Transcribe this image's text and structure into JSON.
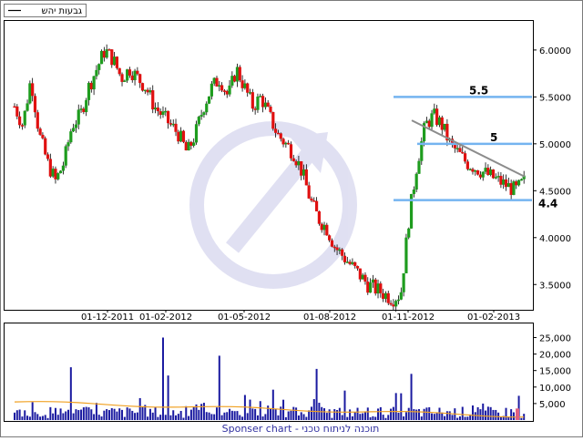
{
  "legend": {
    "label": "גבעות יהש"
  },
  "footer": {
    "text": "Sponser chart - תוכנה לניתוח טכני"
  },
  "colors": {
    "up": "#1e9c1e",
    "down": "#e01010",
    "wick": "#000000",
    "level_line": "#74b4f0",
    "trend_line": "#8c8c8c",
    "volume_bar": "#1a1aa0",
    "volume_ma": "#f0a020",
    "watermark": "#c8c8e8",
    "frame": "#7a7a7a"
  },
  "chart_data": [
    {
      "type": "candlestick",
      "title": "",
      "x_tick_labels": [
        "01-12-2011",
        "01-02-2012",
        "01-05-2012",
        "01-08-2012",
        "01-11-2012",
        "01-02-2013"
      ],
      "y_tick_labels": [
        "3.5000",
        "4.0000",
        "4.5000",
        "5.0000",
        "5.5000",
        "6.0000"
      ],
      "y_ticks": [
        3.5,
        4.0,
        4.5,
        5.0,
        5.5,
        6.0
      ],
      "ylim": [
        3.25,
        6.3
      ],
      "date_range": [
        "2011-10",
        "2013-02"
      ],
      "grid": false,
      "closes": [
        5.4,
        5.2,
        5.7,
        5.1,
        4.8,
        4.6,
        4.8,
        5.2,
        5.3,
        5.6,
        5.8,
        6.0,
        5.9,
        5.7,
        5.8,
        5.7,
        5.6,
        5.4,
        5.3,
        5.2,
        5.1,
        4.9,
        5.1,
        5.4,
        5.6,
        5.7,
        5.5,
        5.8,
        5.6,
        5.4,
        5.5,
        5.3,
        5.1,
        5.0,
        4.9,
        4.7,
        4.4,
        4.2,
        4.1,
        3.9,
        3.8,
        3.7,
        3.6,
        3.5,
        3.45,
        3.4,
        3.35,
        3.4,
        4.2,
        4.8,
        5.2,
        5.3,
        5.2,
        5.0,
        4.9,
        4.8,
        4.75,
        4.7,
        4.65,
        4.6,
        4.55,
        4.5,
        4.6
      ],
      "horizontal_levels": [
        {
          "value": 5.5,
          "label": "5.5"
        },
        {
          "value": 5.0,
          "label": "5"
        },
        {
          "value": 4.4,
          "label": "4.4"
        }
      ],
      "trendline": {
        "from": [
          "2012-11",
          5.25
        ],
        "to": [
          "2013-02",
          4.65
        ]
      }
    },
    {
      "type": "bar",
      "title": "",
      "y_tick_labels": [
        "5,000",
        "10,000",
        "15,000",
        "20,000",
        "25,000"
      ],
      "y_ticks": [
        5000,
        10000,
        15000,
        20000,
        25000
      ],
      "ylim": [
        0,
        29000
      ],
      "spikes": [
        25000,
        19500,
        16000,
        15500,
        14000,
        13500
      ],
      "moving_average_start": 5500,
      "moving_average_end": 1200
    }
  ]
}
